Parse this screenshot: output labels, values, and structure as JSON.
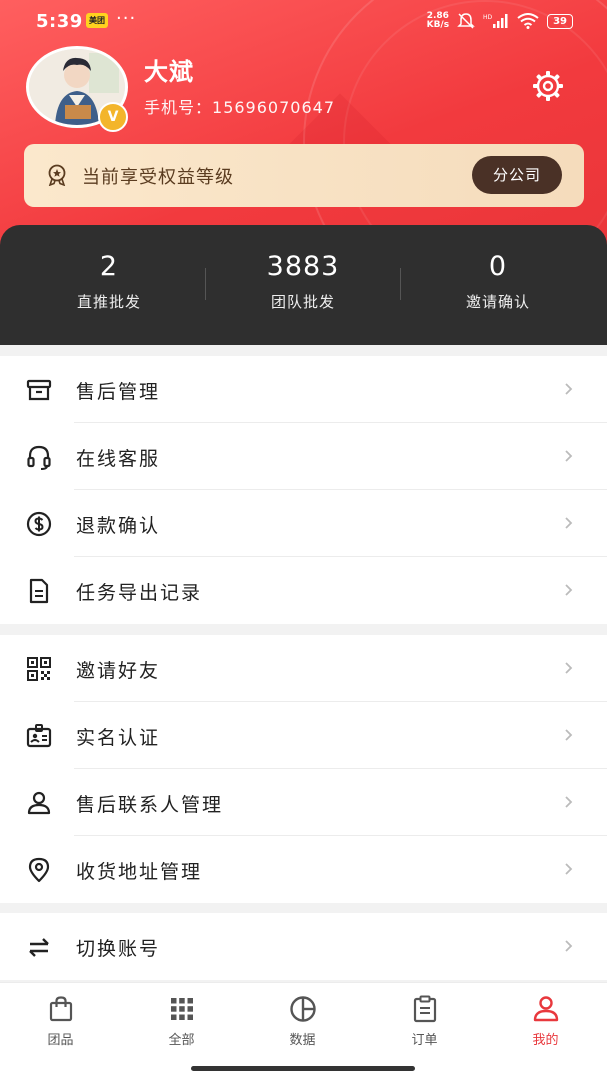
{
  "status": {
    "time": "5:39",
    "app_badge": "美团",
    "dots": "···",
    "net_speed": "2.86",
    "net_unit": "KB/s",
    "signal": "HD",
    "battery": "39"
  },
  "profile": {
    "name": "大斌",
    "phone_label": "手机号：",
    "phone": "15696070647",
    "level_badge": "V"
  },
  "rights": {
    "text": "当前享受权益等级",
    "button": "分公司"
  },
  "stats": [
    {
      "value": "2",
      "label": "直推批发"
    },
    {
      "value": "3883",
      "label": "团队批发"
    },
    {
      "value": "0",
      "label": "邀请确认"
    }
  ],
  "menu": {
    "group1": [
      {
        "label": "售后管理",
        "icon": "archive-box-icon"
      },
      {
        "label": "在线客服",
        "icon": "headset-icon"
      },
      {
        "label": "退款确认",
        "icon": "dollar-circle-icon"
      },
      {
        "label": "任务导出记录",
        "icon": "document-icon"
      }
    ],
    "group2": [
      {
        "label": "邀请好友",
        "icon": "qr-code-icon"
      },
      {
        "label": "实名认证",
        "icon": "id-card-icon"
      },
      {
        "label": "售后联系人管理",
        "icon": "person-icon"
      },
      {
        "label": "收货地址管理",
        "icon": "location-pin-icon"
      }
    ],
    "group3": [
      {
        "label": "切换账号",
        "icon": "switch-arrows-icon"
      }
    ]
  },
  "tabs": [
    {
      "label": "团品",
      "icon": "shopping-bag-icon"
    },
    {
      "label": "全部",
      "icon": "grid-icon"
    },
    {
      "label": "数据",
      "icon": "pie-chart-icon"
    },
    {
      "label": "订单",
      "icon": "clipboard-icon"
    },
    {
      "label": "我的",
      "icon": "user-icon",
      "active": true
    }
  ],
  "colors": {
    "primary_red": "#f23a3e",
    "stats_bg": "#2f2f2f",
    "rights_btn": "#4a3126",
    "badge_gold": "#f3b52b"
  }
}
